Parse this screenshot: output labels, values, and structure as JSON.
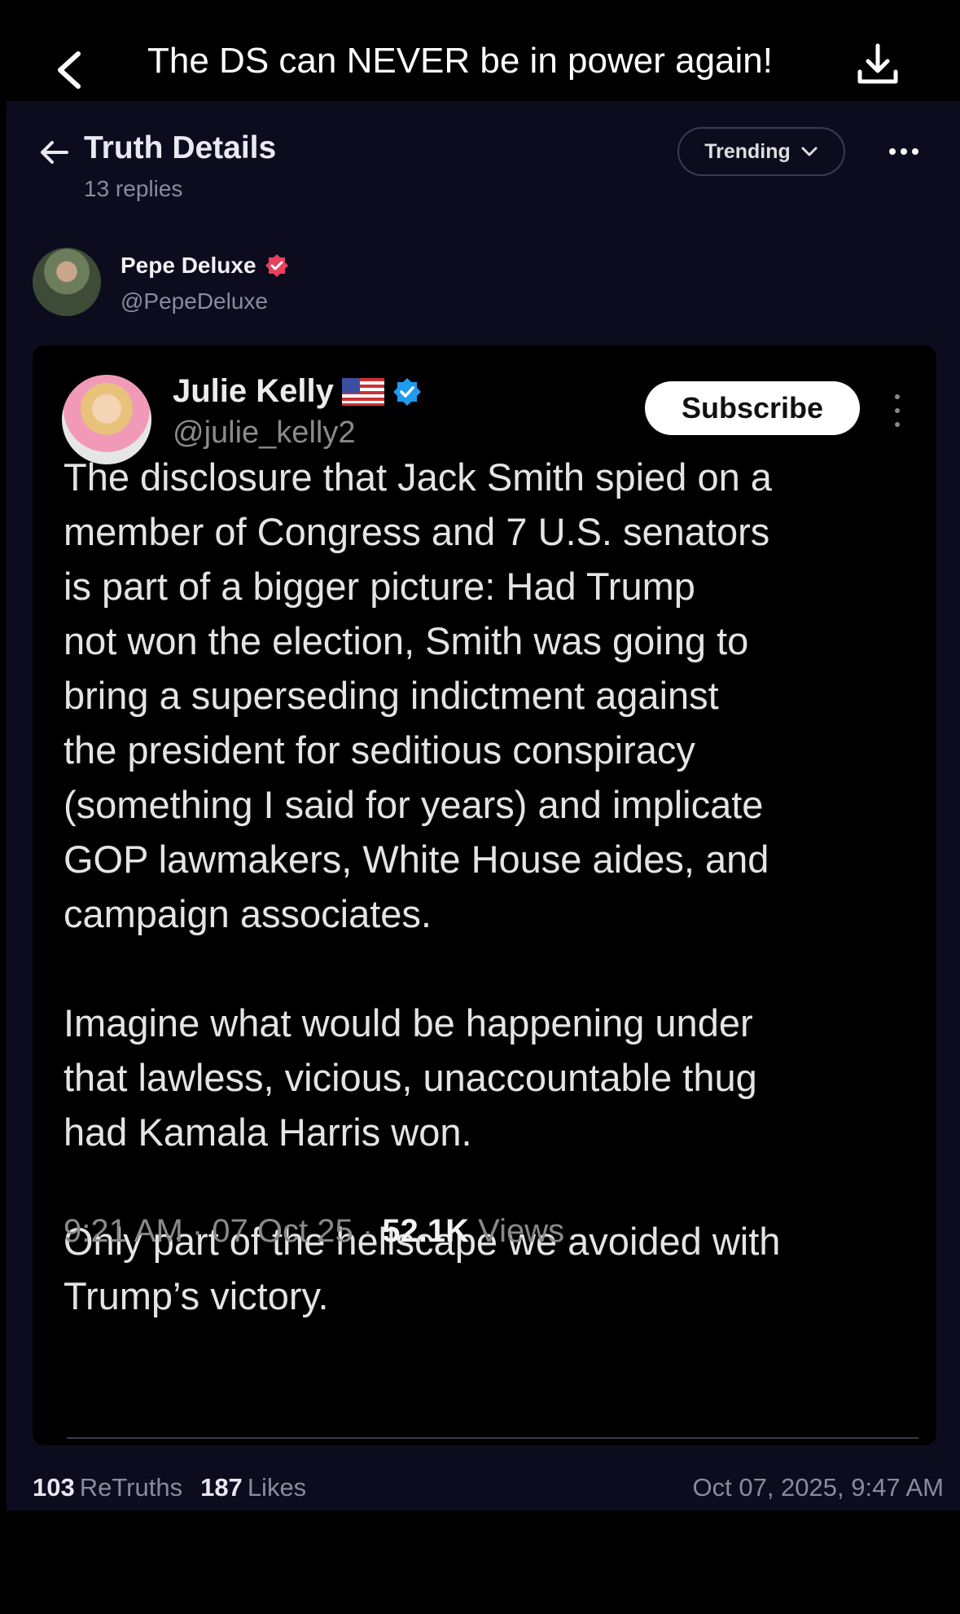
{
  "app": {
    "title": "The DS can NEVER be in power again!"
  },
  "header": {
    "title": "Truth Details",
    "replies": "13 replies",
    "sort_label": "Trending"
  },
  "author": {
    "name": "Pepe Deluxe",
    "handle": "@PepeDeluxe"
  },
  "embedded_post": {
    "name": "Julie Kelly",
    "handle": "@julie_kelly2",
    "subscribe_label": "Subscribe",
    "text": "The disclosure that Jack Smith spied on a\nmember of Congress and 7 U.S. senators\nis part of a bigger picture: Had Trump\nnot won the election, Smith was going to\nbring a superseding indictment against\nthe president for seditious conspiracy\n(something I said for years) and implicate\nGOP lawmakers, White House aides, and\ncampaign associates.\n\nImagine what would be happening under\nthat lawless, vicious, unaccountable thug\nhad Kamala Harris won.\n\nOnly part of the hellscape we avoided with\nTrump’s victory.",
    "time": "9:21 AM · 07 Oct 25 · ",
    "views_count": "52.1K",
    "views_label": " Views"
  },
  "stats": {
    "retruths_count": "103",
    "retruths_label": "ReTruths",
    "likes_count": "187",
    "likes_label": "Likes",
    "posted_at": "Oct 07, 2025, 9:47 AM"
  },
  "colors": {
    "panel_bg": "#0c0c1e",
    "verified_red": "#e8405c",
    "verified_blue": "#1d9bf0"
  }
}
